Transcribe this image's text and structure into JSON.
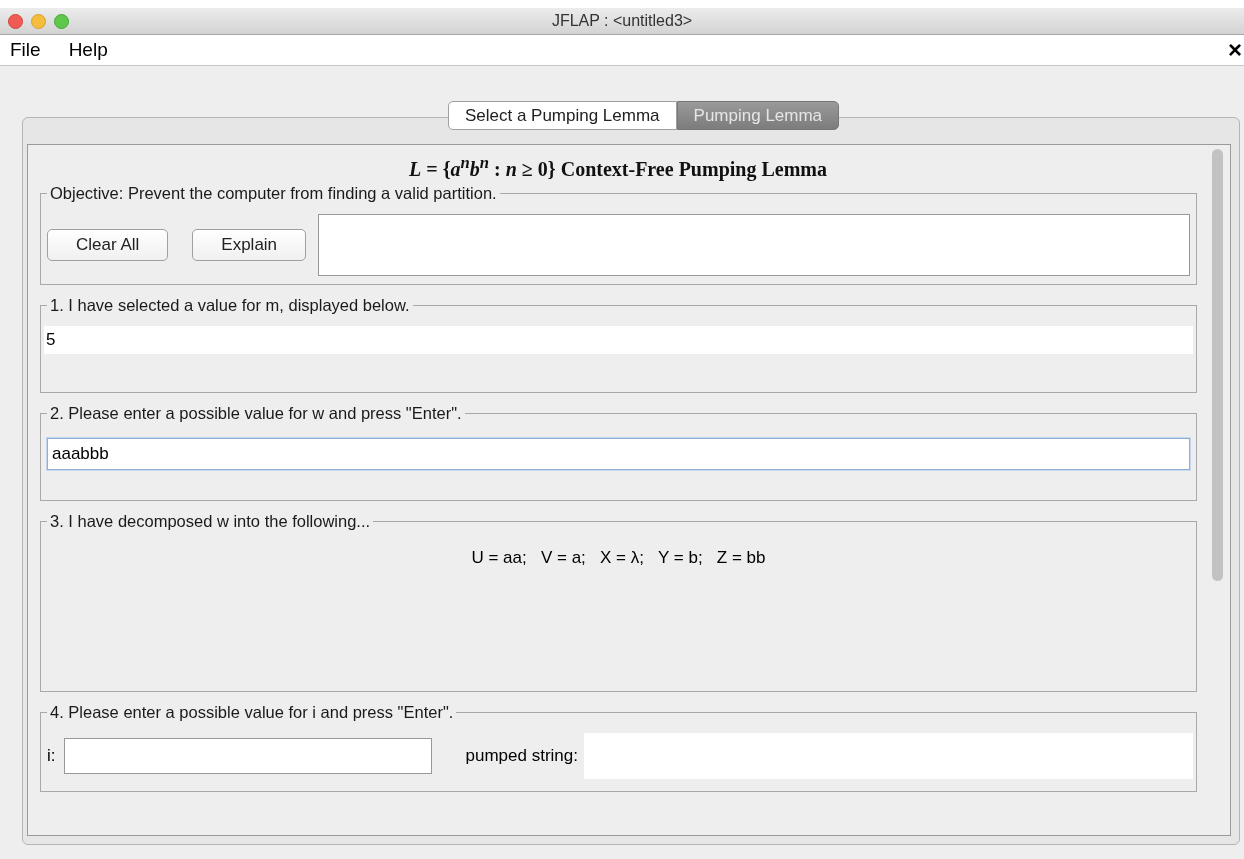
{
  "window": {
    "title": "JFLAP : <untitled3>"
  },
  "menu": [
    {
      "label": "File"
    },
    {
      "label": "Help"
    }
  ],
  "menu_close": "×",
  "tabs": [
    {
      "label": "Select a Pumping Lemma",
      "selected": false
    },
    {
      "label": "Pumping Lemma",
      "selected": true
    }
  ],
  "heading": "*L* = {*a*$^{n}$*b*$^{n}$ : *n* ≥ 0} Context-Free Pumping Lemma",
  "objective": {
    "legend": "Objective: Prevent the computer from finding a valid partition.",
    "buttons": [
      "Clear All",
      "Explain"
    ]
  },
  "step1": {
    "legend": "1. I have selected a value for m, displayed below.",
    "value": "5"
  },
  "step2": {
    "legend": "2. Please enter a possible value for w and press \"Enter\".",
    "value": "aaabbb",
    "focused": true
  },
  "step3": {
    "legend": "3. I have decomposed w into the following...",
    "decomposition": "U = aa;   V = a;   X = λ;   Y = b;   Z = bb"
  },
  "step4": {
    "legend": "4. Please enter a possible value for i and press \"Enter\".",
    "i_label": "i:",
    "pumped_label": "pumped string:"
  }
}
